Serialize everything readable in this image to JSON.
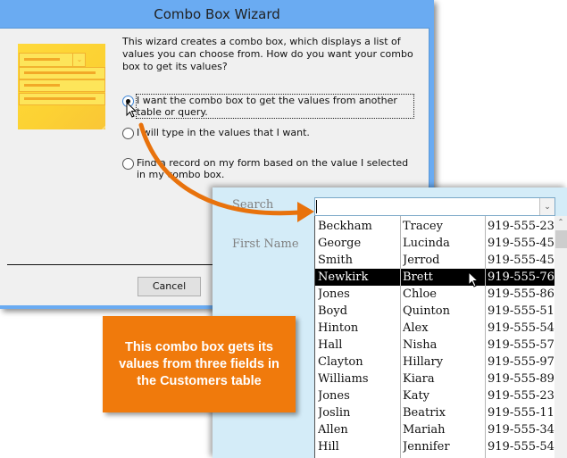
{
  "dialog": {
    "title": "Combo Box Wizard",
    "intro": "This wizard creates a combo box, which displays a list of values you can choose from.  How do you want your combo box to get its values?",
    "options": [
      {
        "label": "I want the combo box to get the values from another table or query.",
        "selected": true
      },
      {
        "label": "I will type in the values that I want.",
        "selected": false
      },
      {
        "label": "Find a record on my form based on the value I selected in my combo box.",
        "selected": false
      }
    ],
    "cancel_label": "Cancel"
  },
  "form": {
    "search_label": "Search",
    "first_name_label": "First Name",
    "search_value": "",
    "rows": [
      {
        "last": "Beckham",
        "first": "Tracey",
        "phone": "919-555-23"
      },
      {
        "last": "George",
        "first": "Lucinda",
        "phone": "919-555-45"
      },
      {
        "last": "Smith",
        "first": "Jerrod",
        "phone": "919-555-45"
      },
      {
        "last": "Newkirk",
        "first": "Brett",
        "phone": "919-555-76",
        "selected": true
      },
      {
        "last": "Jones",
        "first": "Chloe",
        "phone": "919-555-86"
      },
      {
        "last": "Boyd",
        "first": "Quinton",
        "phone": "919-555-51"
      },
      {
        "last": "Hinton",
        "first": "Alex",
        "phone": "919-555-54"
      },
      {
        "last": "Hall",
        "first": "Nisha",
        "phone": "919-555-57"
      },
      {
        "last": "Clayton",
        "first": "Hillary",
        "phone": "919-555-97"
      },
      {
        "last": "Williams",
        "first": "Kiara",
        "phone": "919-555-89"
      },
      {
        "last": "Jones",
        "first": "Katy",
        "phone": "919-555-23"
      },
      {
        "last": "Joslin",
        "first": "Beatrix",
        "phone": "919-555-11"
      },
      {
        "last": "Allen",
        "first": "Mariah",
        "phone": "919-555-34"
      },
      {
        "last": "Hill",
        "first": "Jennifer",
        "phone": "919-555-54"
      }
    ]
  },
  "callout": {
    "text": "This combo box gets its values from three fields in the Customers table"
  },
  "colors": {
    "accent_orange": "#f07a0c",
    "dialog_frame": "#6aabf2",
    "form_background": "#d4ecf8"
  }
}
